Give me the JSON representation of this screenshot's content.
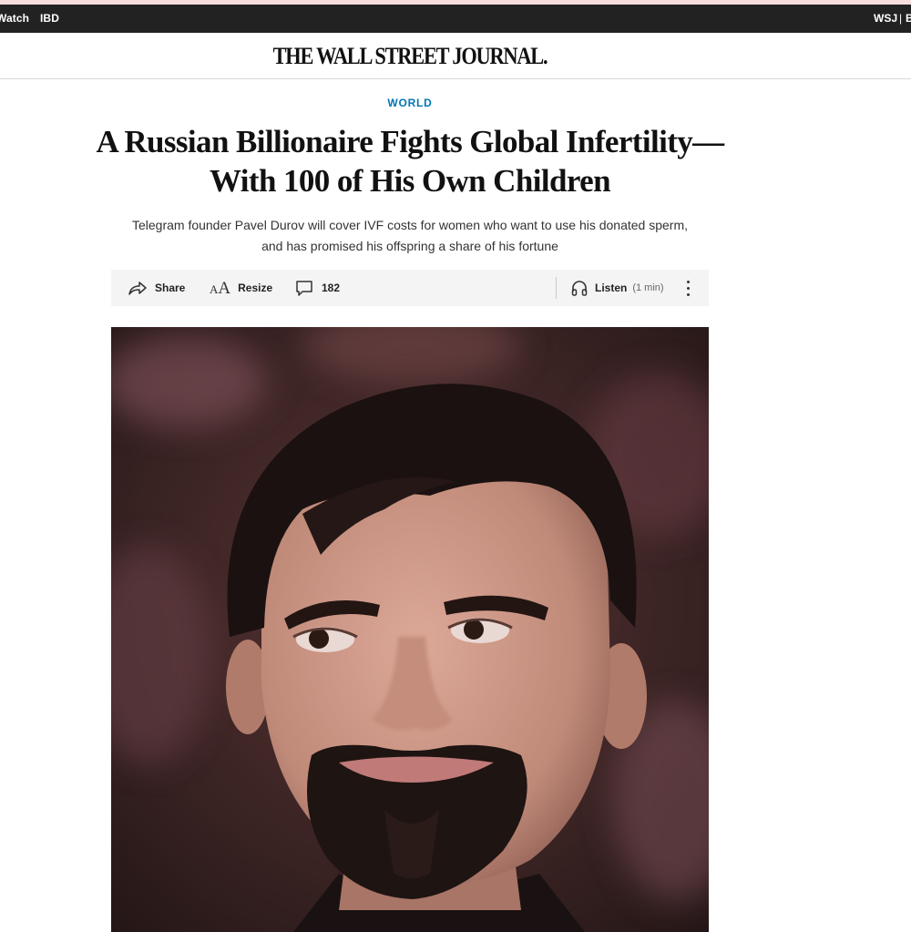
{
  "top_nav": {
    "left_links": [
      "Watch",
      "IBD"
    ],
    "right_links": [
      "WSJ",
      "|",
      "B"
    ]
  },
  "masthead": {
    "logo": "THE WALL STREET JOURNAL."
  },
  "article": {
    "section": "WORLD",
    "headline_line1": "A Russian Billionaire Fights Global Infertility—",
    "headline_line2": "With 100 of His Own Children",
    "dek_line1": "Telegram founder Pavel Durov will cover IVF costs for women who want to use his donated sperm,",
    "dek_line2": "and has promised his offspring a share of his fortune"
  },
  "toolbar": {
    "share_label": "Share",
    "resize_label": "Resize",
    "resize_icon_small": "A",
    "resize_icon_large": "A",
    "comments_count": "182",
    "listen_label": "Listen",
    "listen_duration": "(1 min)",
    "icons": [
      "share-arrow-icon",
      "text-resize-icon",
      "comment-bubble-icon",
      "headphones-icon",
      "more-vertical-icon"
    ]
  },
  "photo": {
    "colors": {
      "background": "#3b2424",
      "hair": "#1a1110",
      "skin": "#c99483",
      "beard": "#1e1412",
      "lips": "#c07a78"
    }
  },
  "colors": {
    "section_accent": "#0274b6",
    "topbar": "#222222",
    "pinkbar": "#f6dede"
  }
}
